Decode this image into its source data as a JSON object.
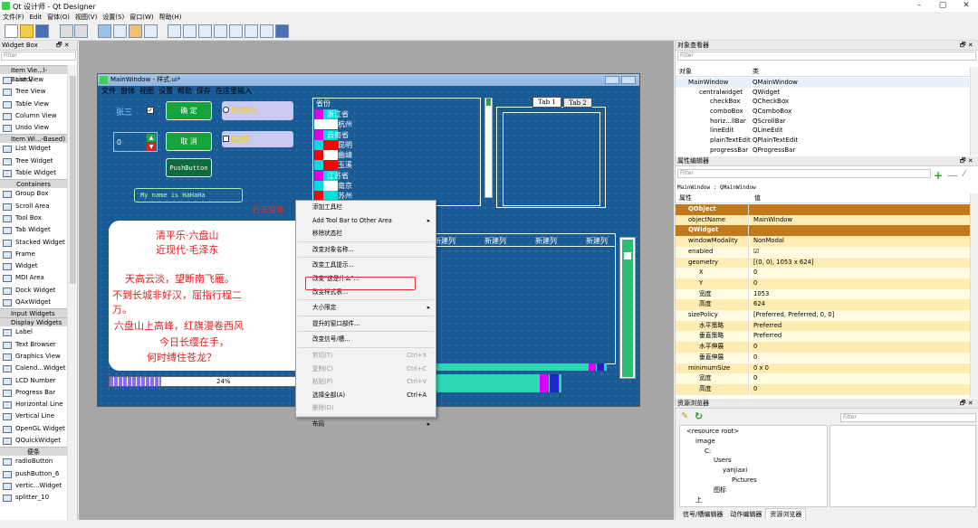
{
  "app": {
    "title": "Qt 设计师 - Qt Designer"
  },
  "menubar": [
    "文件(F)",
    "Edit",
    "窗体(O)",
    "视图(V)",
    "设置(S)",
    "窗口(W)",
    "帮助(H)"
  ],
  "widget_box": {
    "title": "Widget Box",
    "filter_placeholder": "Filter",
    "items": [
      {
        "type": "cat",
        "label": "Item Vie...l-Based)"
      },
      {
        "type": "item",
        "label": "List View"
      },
      {
        "type": "item",
        "label": "Tree View"
      },
      {
        "type": "item",
        "label": "Table View"
      },
      {
        "type": "item",
        "label": "Column View"
      },
      {
        "type": "item",
        "label": "Undo View"
      },
      {
        "type": "cat",
        "label": "Item Wi...-Based)"
      },
      {
        "type": "item",
        "label": "List Widget"
      },
      {
        "type": "item",
        "label": "Tree Widget"
      },
      {
        "type": "item",
        "label": "Table Widget"
      },
      {
        "type": "catc",
        "label": "Containers"
      },
      {
        "type": "item",
        "label": "Group Box"
      },
      {
        "type": "item",
        "label": "Scroll Area"
      },
      {
        "type": "item",
        "label": "Tool Box"
      },
      {
        "type": "item",
        "label": "Tab Widget"
      },
      {
        "type": "item",
        "label": "Stacked Widget"
      },
      {
        "type": "item",
        "label": "Frame"
      },
      {
        "type": "item",
        "label": "Widget"
      },
      {
        "type": "item",
        "label": "MDI Area"
      },
      {
        "type": "item",
        "label": "Dock Widget"
      },
      {
        "type": "item",
        "label": "QAxWidget"
      },
      {
        "type": "cat",
        "label": "Input Widgets"
      },
      {
        "type": "cat",
        "label": "Display Widgets"
      },
      {
        "type": "item",
        "label": "Label"
      },
      {
        "type": "item",
        "label": "Text Browser"
      },
      {
        "type": "item",
        "label": "Graphics View"
      },
      {
        "type": "item",
        "label": "Calend...Widget"
      },
      {
        "type": "item",
        "label": "LCD Number"
      },
      {
        "type": "item",
        "label": "Progress Bar"
      },
      {
        "type": "item",
        "label": "Horizontal Line"
      },
      {
        "type": "item",
        "label": "Vertical Line"
      },
      {
        "type": "item",
        "label": "OpenGL Widget"
      },
      {
        "type": "item",
        "label": "QQuickWidget"
      },
      {
        "type": "catc",
        "label": "便条"
      },
      {
        "type": "item",
        "label": "radioButton"
      },
      {
        "type": "item",
        "label": "pushButton_6"
      },
      {
        "type": "item",
        "label": "vertic...Widget"
      },
      {
        "type": "item",
        "label": "splitter_10"
      }
    ]
  },
  "form": {
    "title": "MainWindow - 样式.ui*",
    "menu": [
      "文件",
      "窗体",
      "视图",
      "设置",
      "帮助",
      "保存",
      "在这里输入"
    ],
    "label_zhangsan": "张三",
    "btn_ok": "确 定",
    "btn_cancel": "取 消",
    "btn_push": "PushButton",
    "radio_label": "单选按钮",
    "check_label": "复选框",
    "spin_value": "0",
    "lineedit": "My name is HaHaHa",
    "province_header": "省份",
    "provinces": [
      "浙江省",
      "杭州",
      "云南省",
      "昆明",
      "曲靖",
      "玉溪",
      "江苏省",
      "南京",
      "苏州"
    ],
    "tab1": "Tab 1",
    "tab2": "Tab 2",
    "table_cols": [
      "新建列",
      "新建列",
      "新建列",
      "新建列"
    ],
    "progress_text": "24%",
    "progress_value": 0.24,
    "annotation": "右击窗体",
    "poem": [
      "清平乐·六盘山",
      "近现代·毛泽东",
      "天高云淡，望断南飞雁。",
      "不到长城非好汉，屈指行程二",
      "万。",
      "六盘山上高峰，红旗漫卷西风",
      "今日长缨在手，",
      "何时缚住苍龙？"
    ]
  },
  "context_menu": [
    {
      "label": "添加工具栏"
    },
    {
      "label": "Add Tool Bar to Other Area",
      "arrow": true
    },
    {
      "label": "移除状态栏"
    },
    {
      "sep": true
    },
    {
      "label": "改变对象名称..."
    },
    {
      "sep": true
    },
    {
      "label": "改变工具提示..."
    },
    {
      "label": "改变\"这是什么\"..."
    },
    {
      "label": "改变样式表...",
      "highlight": true
    },
    {
      "sep": true
    },
    {
      "label": "大小限定",
      "arrow": true
    },
    {
      "sep": true
    },
    {
      "label": "提升的窗口部件..."
    },
    {
      "sep": true
    },
    {
      "label": "改变信号/槽..."
    },
    {
      "sep": true
    },
    {
      "label": "剪切(T)",
      "shortcut": "Ctrl+X",
      "disabled": true
    },
    {
      "label": "复制(C)",
      "shortcut": "Ctrl+C",
      "disabled": true
    },
    {
      "label": "粘贴(P)",
      "shortcut": "Ctrl+V",
      "disabled": true
    },
    {
      "label": "选择全部(A)",
      "shortcut": "Ctrl+A"
    },
    {
      "label": "删除(D)",
      "disabled": true
    },
    {
      "sep": true
    },
    {
      "label": "布局",
      "arrow": true
    }
  ],
  "object_inspector": {
    "title": "对象查看器",
    "filter_placeholder": "Filter",
    "col_object": "对象",
    "col_class": "类",
    "rows": [
      {
        "obj": "MainWindow",
        "cls": "QMainWindow",
        "indent": 0
      },
      {
        "obj": "centralwidget",
        "cls": "QWidget",
        "indent": 1
      },
      {
        "obj": "checkBox",
        "cls": "QCheckBox",
        "indent": 2
      },
      {
        "obj": "comboBox",
        "cls": "QComboBox",
        "indent": 2
      },
      {
        "obj": "horiz...llBar",
        "cls": "QScrollBar",
        "indent": 2
      },
      {
        "obj": "lineEdit",
        "cls": "QLineEdit",
        "indent": 2
      },
      {
        "obj": "plainTextEdit",
        "cls": "QPlainTextEdit",
        "indent": 2
      },
      {
        "obj": "progressBar",
        "cls": "QProgressBar",
        "indent": 2
      }
    ]
  },
  "property_editor": {
    "title": "属性编辑器",
    "filter_placeholder": "Filter",
    "context": "MainWindow : QMainWindow",
    "col_prop": "属性",
    "col_val": "值",
    "rows": [
      {
        "k": "QObject",
        "v": "",
        "group": true
      },
      {
        "k": "objectName",
        "v": "MainWindow"
      },
      {
        "k": "QWidget",
        "v": "",
        "group": true
      },
      {
        "k": "windowModality",
        "v": "NonModal"
      },
      {
        "k": "enabled",
        "v": "☑"
      },
      {
        "k": "geometry",
        "v": "[(0, 0), 1053 x 624]"
      },
      {
        "k": "X",
        "v": "0",
        "sub": true
      },
      {
        "k": "Y",
        "v": "0",
        "sub": true
      },
      {
        "k": "宽度",
        "v": "1053",
        "sub": true
      },
      {
        "k": "高度",
        "v": "624",
        "sub": true
      },
      {
        "k": "sizePolicy",
        "v": "[Preferred, Preferred, 0, 0]"
      },
      {
        "k": "水平策略",
        "v": "Preferred",
        "sub": true
      },
      {
        "k": "垂直策略",
        "v": "Preferred",
        "sub": true
      },
      {
        "k": "水平伸展",
        "v": "0",
        "sub": true
      },
      {
        "k": "垂直伸展",
        "v": "0",
        "sub": true
      },
      {
        "k": "minimumSize",
        "v": "0 x 0"
      },
      {
        "k": "宽度",
        "v": "0",
        "sub": true
      },
      {
        "k": "高度",
        "v": "0",
        "sub": true
      }
    ]
  },
  "resource_browser": {
    "title": "资源浏览器",
    "filter_placeholder": "Filter",
    "tree": [
      {
        "label": "<resource root>",
        "indent": 0
      },
      {
        "label": "image",
        "indent": 1
      },
      {
        "label": "C:",
        "indent": 2
      },
      {
        "label": "Users",
        "indent": 3
      },
      {
        "label": "yanjiaxi",
        "indent": 4
      },
      {
        "label": "Pictures",
        "indent": 5
      },
      {
        "label": "图标",
        "indent": 3
      },
      {
        "label": "上",
        "indent": 1
      }
    ],
    "tabs": [
      "信号/槽编辑器",
      "动作编辑器",
      "资源浏览器"
    ]
  }
}
